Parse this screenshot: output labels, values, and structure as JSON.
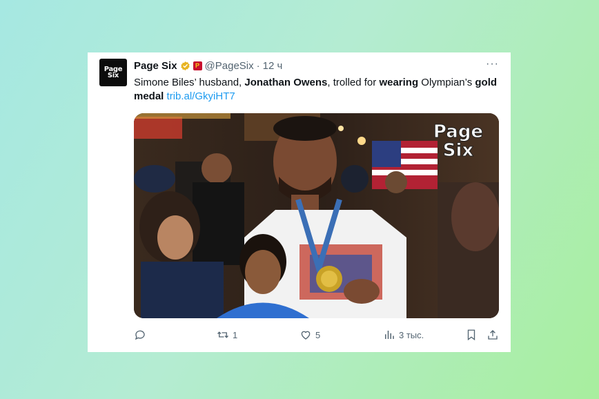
{
  "tweet": {
    "avatar_text_line1": "Page",
    "avatar_text_line2": "Six",
    "display_name": "Page Six",
    "handle": "@PageSix",
    "separator": "·",
    "time": "12 ч",
    "more_label": "···",
    "text_parts": {
      "p1": "Simone Biles’ husband, ",
      "p2": "Jonathan Owens",
      "p3": ", trolled for ",
      "p4": "wearing",
      "p5": " Olympian’s ",
      "p6": "gold medal",
      "p7": " ",
      "link": "trib.al/GkyiHT7"
    },
    "image_watermark_line1": "Page",
    "image_watermark_line2": "Six"
  },
  "actions": {
    "reply_count": "",
    "retweet_count": "1",
    "like_count": "5",
    "views_count": "3 тыс."
  },
  "colors": {
    "link": "#1d9bf0",
    "muted": "#536471",
    "verified_badge": "#e8b422",
    "affiliate_badge": "#c8102e"
  }
}
